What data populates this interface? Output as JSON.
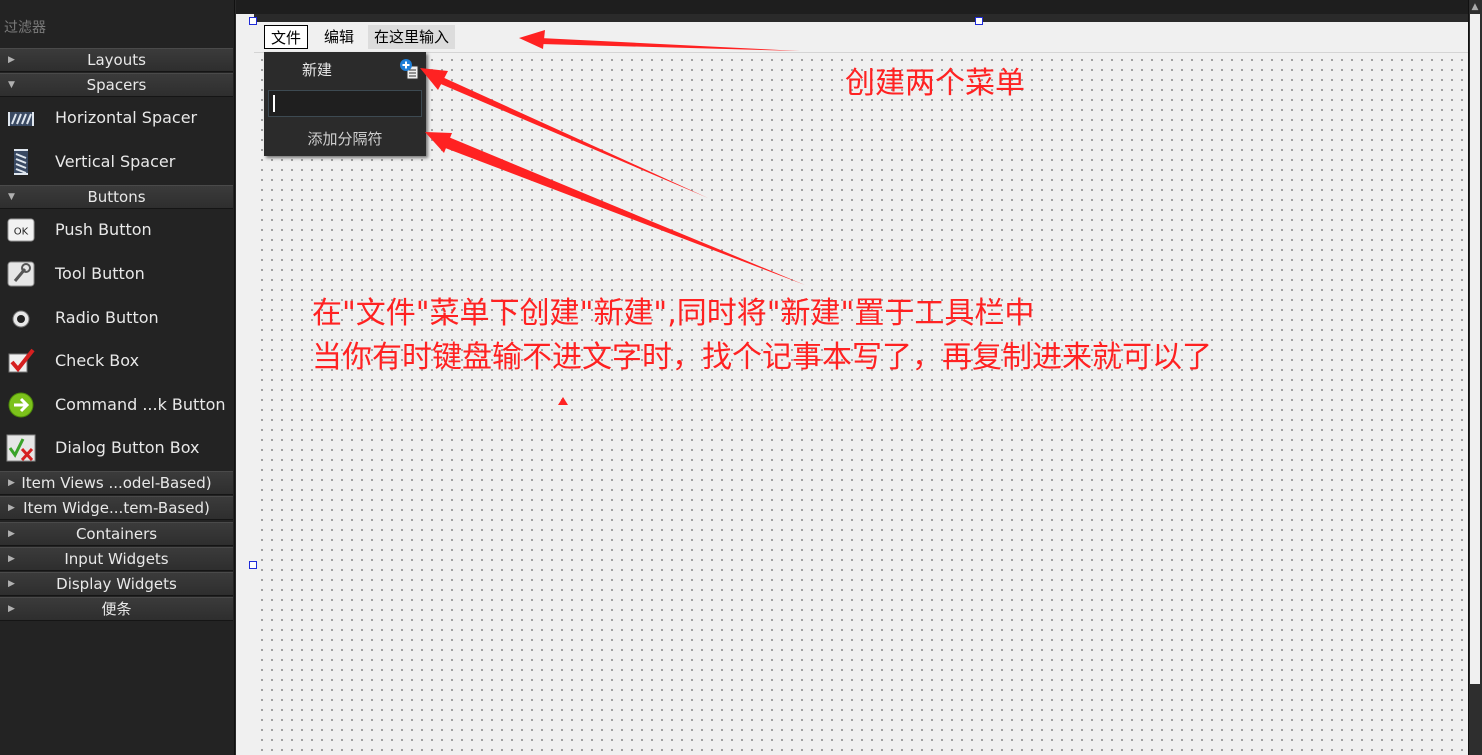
{
  "sidebar": {
    "filter_label": "过滤器",
    "categories": {
      "layouts": "Layouts",
      "spacers": "Spacers",
      "buttons": "Buttons",
      "item_views": "Item Views ...odel-Based)",
      "item_widgets": "Item Widge...tem-Based)",
      "containers": "Containers",
      "input_widgets": "Input Widgets",
      "display_widgets": "Display Widgets",
      "notes": "便条"
    },
    "items": {
      "horizontal_spacer": "Horizontal Spacer",
      "vertical_spacer": "Vertical Spacer",
      "push_button": "Push Button",
      "tool_button": "Tool Button",
      "radio_button": "Radio Button",
      "check_box": "Check Box",
      "command_link_button": "Command ...k Button",
      "dialog_button_box": "Dialog Button Box"
    },
    "push_button_icon_text": "OK"
  },
  "menubar": {
    "file": "文件",
    "edit": "编辑",
    "type_here": "在这里输入"
  },
  "dropdown": {
    "new_action": "新建",
    "add_separator": "添加分隔符"
  },
  "annotations": {
    "note1": "创建两个菜单",
    "note2": "在\"文件\"菜单下创建\"新建\",同时将\"新建\"置于工具栏中",
    "note3": "当你有时键盘输不进文字时，找个记事本写了，再复制进来就可以了"
  },
  "colors": {
    "annotation": "#ff2222",
    "selection_handle": "#1f2bd8",
    "sidebar_bg": "#232323",
    "canvas_bg": "#f0f0f0"
  }
}
